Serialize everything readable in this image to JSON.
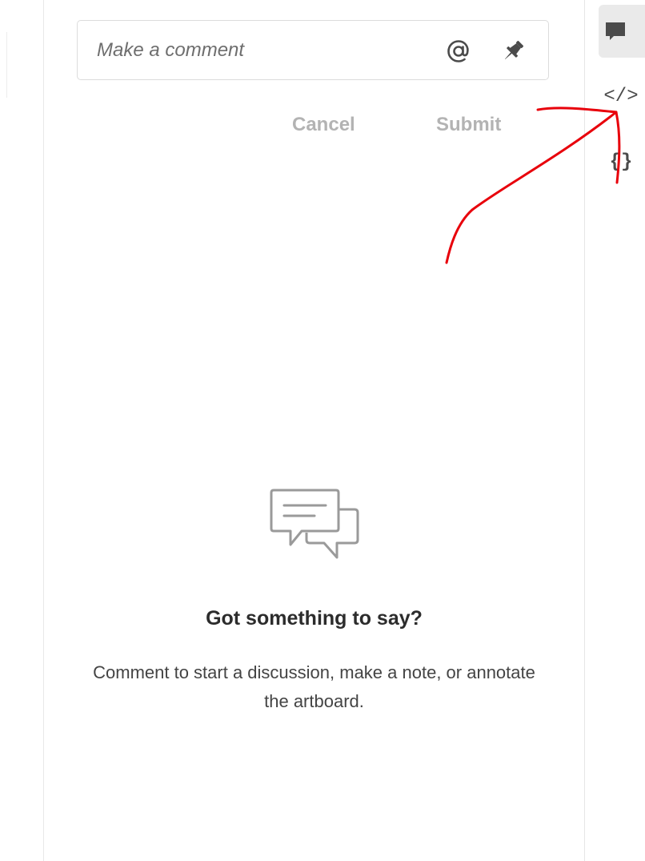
{
  "comment": {
    "placeholder": "Make a comment",
    "cancel_label": "Cancel",
    "submit_label": "Submit",
    "mention_icon": "at-icon",
    "pin_icon": "pin-icon"
  },
  "empty_state": {
    "icon": "speech-bubbles-icon",
    "title": "Got something to say?",
    "description": "Comment to start a discussion, make a note, or annotate the artboard."
  },
  "right_rail": {
    "items": [
      {
        "name": "comments",
        "icon": "comment-icon",
        "active": true
      },
      {
        "name": "code",
        "glyph": "</>",
        "icon": "code-icon",
        "active": false
      },
      {
        "name": "json",
        "glyph": "{}",
        "icon": "braces-icon",
        "active": false
      }
    ]
  },
  "colors": {
    "annotation": "#e8000b",
    "disabled_text": "#b3b3b3",
    "active_rail": "#eaeaea"
  }
}
